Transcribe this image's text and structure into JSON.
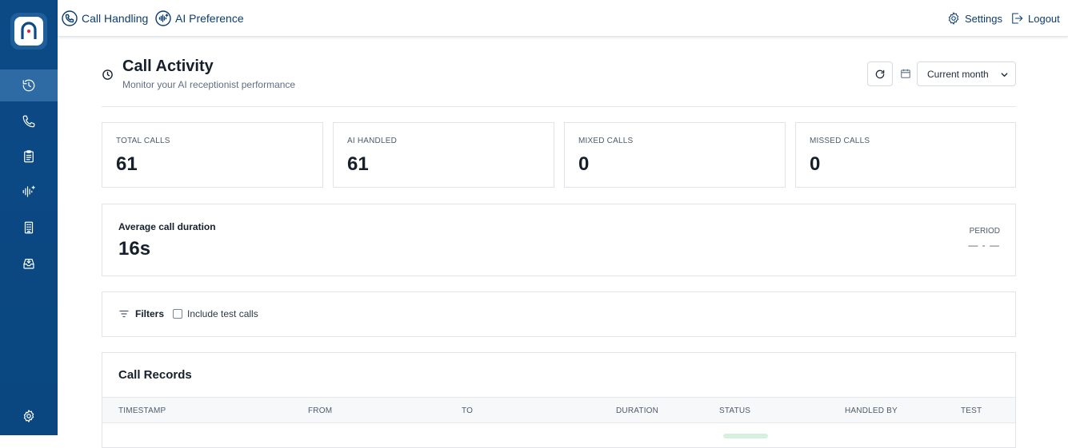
{
  "topbar": {
    "call_handling": "Call Handling",
    "ai_preference": "AI Preference",
    "settings": "Settings",
    "logout": "Logout"
  },
  "sidebar": {
    "items": [
      {
        "icon": "history-icon",
        "active": true
      },
      {
        "icon": "phone-icon",
        "active": false
      },
      {
        "icon": "clipboard-icon",
        "active": false
      },
      {
        "icon": "ai-voice-icon",
        "active": false
      },
      {
        "icon": "building-icon",
        "active": false
      },
      {
        "icon": "inbox-icon",
        "active": false
      }
    ],
    "bottom_icon": "gear-icon"
  },
  "page": {
    "title": "Call Activity",
    "subtitle": "Monitor your AI receptionist performance",
    "period_selected": "Current month"
  },
  "stats": [
    {
      "label": "TOTAL CALLS",
      "value": "61"
    },
    {
      "label": "AI HANDLED",
      "value": "61"
    },
    {
      "label": "MIXED CALLS",
      "value": "0"
    },
    {
      "label": "MISSED CALLS",
      "value": "0"
    }
  ],
  "average": {
    "label": "Average call duration",
    "value": "16s",
    "period_label": "PERIOD",
    "period_value": "— - —"
  },
  "filters": {
    "label": "Filters",
    "include_test_label": "Include test calls"
  },
  "records": {
    "title": "Call Records",
    "columns": [
      "TIMESTAMP",
      "FROM",
      "TO",
      "DURATION",
      "STATUS",
      "HANDLED BY",
      "TEST"
    ]
  },
  "colors": {
    "sidebar": "#0c4a86",
    "accent": "#0b3d6e"
  }
}
